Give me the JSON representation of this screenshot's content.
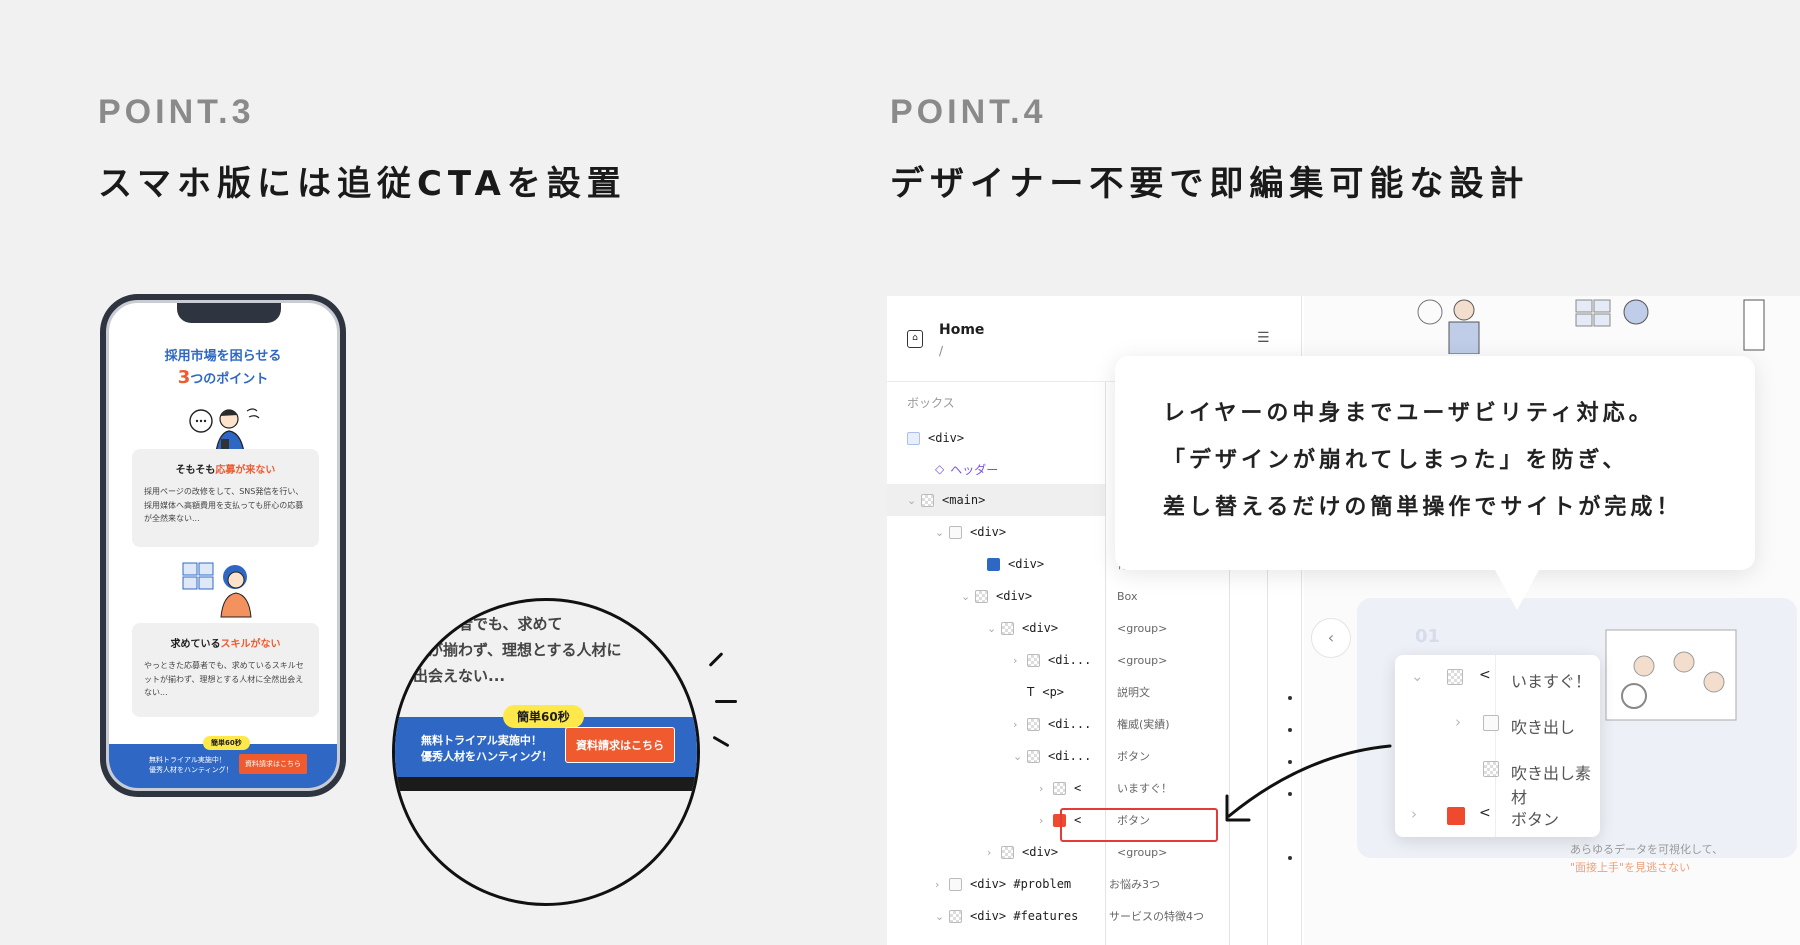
{
  "point3": {
    "label": "POINT.3",
    "title": "スマホ版には追従CTAを設置"
  },
  "point4": {
    "label": "POINT.4",
    "title": "デザイナー不要で即編集可能な設計"
  },
  "phone": {
    "heading1": "採用市場を困らせる",
    "heading2_num": "3",
    "heading2_rest": "つのポイント",
    "card1": {
      "title_pre": "そもそも",
      "title_em": "応募が来ない",
      "body": "採用ページの改修をして、SNS発信を行い、採用媒体へ高額費用を支払っても肝心の応募が全然来ない..."
    },
    "card2": {
      "title_pre": "求めている",
      "title_em": "スキルがない",
      "body": "やっときた応募者でも、求めているスキルセットが揃わず、理想とする人材に全然出会えない..."
    },
    "cta": {
      "badge": "簡単60秒",
      "line1": "無料トライアル実施中！",
      "line2": "優秀人材をハンティング！",
      "button": "資料請求はこちら"
    }
  },
  "zoom": {
    "text1": "も応募者でも、求めて",
    "text2": "トが揃わず、理想とする人材に",
    "text3": "出会えない...",
    "badge": "簡単60秒",
    "line1": "無料トライアル実施中！",
    "line2": "優秀人材をハンティング！",
    "button": "資料請求はこちら"
  },
  "editor": {
    "page_title": "Home",
    "page_path": "/",
    "col_box": "ボックス",
    "rows": [
      {
        "tag": "<div>",
        "val": ""
      },
      {
        "tag": "ヘッダー",
        "val": ""
      },
      {
        "tag": "<main>",
        "val": ""
      },
      {
        "tag": "<div>",
        "val": ""
      },
      {
        "tag": "<div>",
        "val": "背景"
      },
      {
        "tag": "<div>",
        "val": "Box"
      },
      {
        "tag": "<div>",
        "val": "<group>"
      },
      {
        "tag": "<di...",
        "val": "<group>"
      },
      {
        "tag": "<p>",
        "val": "説明文"
      },
      {
        "tag": "<di...",
        "val": "権威(実績)"
      },
      {
        "tag": "<di...",
        "val": "ボタン"
      },
      {
        "tag": "<",
        "val": "いますぐ！"
      },
      {
        "tag": "<",
        "val": "ボタン"
      },
      {
        "tag": "<div>",
        "val": "<group>"
      },
      {
        "tag": "<div> #problem",
        "val": "お悩み3つ"
      },
      {
        "tag": "<div> #features",
        "val": "サービスの特徴4つ"
      }
    ]
  },
  "bubble": {
    "line1": "レイヤーの中身までユーザビリティ対応。",
    "line2": "「デザインが崩れてしまった」を防ぎ、",
    "line3": "差し替えるだけの簡単操作でサイトが完成！"
  },
  "popup": {
    "rows": [
      {
        "lt": "<",
        "label": "いますぐ！"
      },
      {
        "lt": "",
        "label": "吹き出し"
      },
      {
        "lt": "",
        "label": "吹き出し素材"
      },
      {
        "lt": "<",
        "label": "ボタン"
      }
    ]
  },
  "preview": {
    "line1": "あらゆるデータを可視化して、",
    "line2": "\"面接上手\"を見逃さない",
    "num": "01"
  }
}
